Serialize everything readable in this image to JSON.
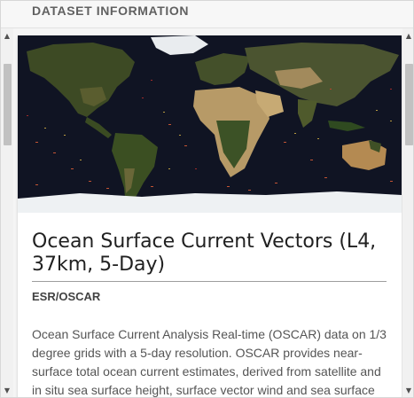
{
  "header": {
    "title": "DATASET INFORMATION"
  },
  "dataset": {
    "title": "Ocean Surface Current Vectors (L4, 37km, 5-Day)",
    "provider": "ESR/OSCAR",
    "description": "Ocean Surface Current Analysis Real-time (OSCAR) data on 1/3 degree grids with a 5-day resolution. OSCAR provides near-surface total ocean current estimates, derived from satellite and in situ sea surface height, surface vector wind and sea surface"
  },
  "map": {
    "ocean_color": "#101423",
    "land_color": "#3e4a26",
    "desert_color": "#b79a67",
    "ice_color": "#f2f4f6",
    "vector_colors": [
      "#ff6a3a",
      "#ffd34d",
      "#ff3b2f"
    ]
  },
  "scrollbars": {
    "up_icon": "arrow-up-icon",
    "down_icon": "arrow-down-icon"
  }
}
